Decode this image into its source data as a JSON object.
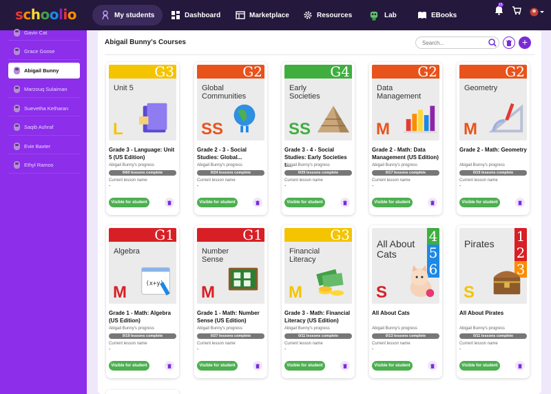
{
  "app": {
    "logo_letters": [
      {
        "ch": "s",
        "color": "#e53935"
      },
      {
        "ch": "c",
        "color": "#fb8c00"
      },
      {
        "ch": "h",
        "color": "#fdd835"
      },
      {
        "ch": "o",
        "color": "#43a047"
      },
      {
        "ch": "o",
        "color": "#1e88e5"
      },
      {
        "ch": "l",
        "color": "#8e24aa"
      },
      {
        "ch": "i",
        "color": "#e53935"
      },
      {
        "ch": "o",
        "color": "#fb8c00"
      }
    ]
  },
  "nav": {
    "items": [
      "My students",
      "Dashboard",
      "Marketplace",
      "Resources",
      "Lab",
      "EBooks"
    ],
    "notif_badge": "15"
  },
  "sidebar": {
    "students": [
      "Gavin Cat",
      "Grace Goose",
      "Abigail Bunny",
      "Marzouq Sulaiman",
      "Suevetha Ketharan",
      "Saqib Ashraf",
      "Evie Baxter",
      "Ethyl Ramos"
    ],
    "active_index": 2
  },
  "main": {
    "title": "Abigail Bunny's Courses",
    "search_placeholder": "Search...",
    "add_label": "+"
  },
  "labels": {
    "progress": "Abigail Bunny's progress",
    "current": "Current lesson name",
    "dash": "-",
    "visible": "Visible for student"
  },
  "courses": [
    {
      "band": "#f4c400",
      "grade": "G3",
      "subject": "Unit 5",
      "letter": "L",
      "letter_color": "#f4c400",
      "art": "notebook-icon",
      "title": "Grade 3 - Language: Unit 5 (US Edition)",
      "progress": "0/60 lessons complete"
    },
    {
      "band": "#e8531c",
      "grade": "G2",
      "subject": "Global Communities",
      "letter": "SS",
      "letter_color": "#e8531c",
      "art": "globe-icon",
      "title": "Grade 2 - 3 - Social Studies: Global...",
      "progress": "0/24 lessons complete"
    },
    {
      "band": "#3fae3f",
      "grade": "G4",
      "subject": "Early Societies",
      "letter": "SS",
      "letter_color": "#3fae3f",
      "art": "pyramid-icon",
      "title": "Grade 3 - 4 - Social Studies: Early Societies t...",
      "progress": "0/25 lessons complete"
    },
    {
      "band": "#e8531c",
      "grade": "G2",
      "subject": "Data Management",
      "letter": "M",
      "letter_color": "#e8531c",
      "art": "bar-chart-icon",
      "title": "Grade 2 - Math: Data Management (US Edition)",
      "progress": "0/17 lessons complete"
    },
    {
      "band": "#e8531c",
      "grade": "G2",
      "subject": "Geometry",
      "letter": "M",
      "letter_color": "#e8531c",
      "art": "ruler-icon",
      "title": "Grade 2 - Math: Geometry",
      "progress": "0/15 lessons complete"
    },
    {
      "band": "#d81f26",
      "grade": "G1",
      "subject": "Algebra",
      "letter": "M",
      "letter_color": "#d81f26",
      "art": "notepad-icon",
      "title": "Grade 1 - Math: Algebra (US Edition)",
      "progress": "0/19 lessons complete"
    },
    {
      "band": "#d81f26",
      "grade": "G1",
      "subject": "Number Sense",
      "letter": "M",
      "letter_color": "#d81f26",
      "art": "chalkboard-icon",
      "title": "Grade 1 - Math: Number Sense (US Edition)",
      "progress": "0/27 lessons complete"
    },
    {
      "band": "#f4c400",
      "grade": "G3",
      "subject": "Financial Literacy",
      "letter": "M",
      "letter_color": "#f4c400",
      "art": "money-icon",
      "title": "Grade 3 - Math: Financial Literacy (US Edition)",
      "progress": "0/11 lessons complete"
    },
    {
      "band": "",
      "grade": "",
      "subject": "All About Cats",
      "letter": "S",
      "letter_color": "#d81f26",
      "art": "cat-icon",
      "title": "All About Cats",
      "progress": "0/13 lessons complete",
      "numbers": [
        "4",
        "5",
        "6"
      ],
      "numcolors": [
        "#3fae3f",
        "#1e88e5",
        "#1e88e5"
      ]
    },
    {
      "band": "",
      "grade": "",
      "subject": "Pirates",
      "letter": "S",
      "letter_color": "#f4c400",
      "art": "treasure-chest-icon",
      "title": "All About Pirates",
      "progress": "0/11 lessons complete",
      "numbers": [
        "1",
        "2",
        "3"
      ],
      "numcolors": [
        "#d81f26",
        "#d81f26",
        "#fb8c00"
      ]
    }
  ]
}
